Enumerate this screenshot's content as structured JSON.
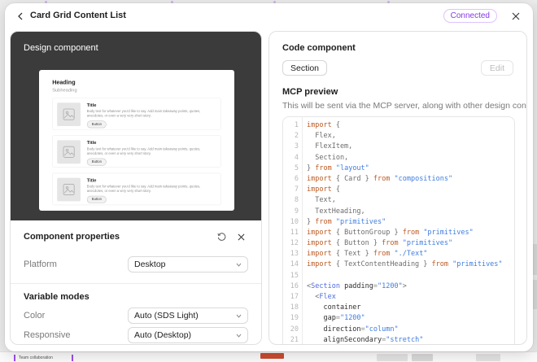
{
  "header": {
    "title": "Card Grid Content List",
    "badge": "Connected"
  },
  "design_panel": {
    "label": "Design component",
    "preview": {
      "heading": "Heading",
      "subheading": "Subheading",
      "cards": [
        {
          "title": "Title",
          "body": "Body text for whatever you'd like to say. Add main takeaway points, quotes, anecdotes, or even a very very short story.",
          "button": "Button"
        },
        {
          "title": "Title",
          "body": "Body text for whatever you'd like to say. Add main takeaway points, quotes, anecdotes, or even a very very short story.",
          "button": "Button"
        },
        {
          "title": "Title",
          "body": "Body text for whatever you'd like to say. Add main takeaway points, quotes, anecdotes, or even a very very short story.",
          "button": "Button"
        }
      ]
    }
  },
  "properties_panel": {
    "title": "Component properties",
    "fields": [
      {
        "label": "Platform",
        "value": "Desktop"
      }
    ],
    "variable_modes": {
      "title": "Variable modes",
      "fields": [
        {
          "label": "Color",
          "value": "Auto (SDS Light)"
        },
        {
          "label": "Responsive",
          "value": "Auto (Desktop)"
        }
      ]
    }
  },
  "code_panel": {
    "title": "Code component",
    "chip": "Section",
    "edit_label": "Edit",
    "mcp": {
      "title": "MCP preview",
      "description": "This will be sent via the MCP server, along with other design context."
    },
    "code": {
      "lines": [
        {
          "n": 1,
          "t": [
            [
              "k",
              "import "
            ],
            [
              "p",
              "{"
            ]
          ]
        },
        {
          "n": 2,
          "t": [
            [
              "p",
              "  Flex,"
            ]
          ]
        },
        {
          "n": 3,
          "t": [
            [
              "p",
              "  FlexItem,"
            ]
          ]
        },
        {
          "n": 4,
          "t": [
            [
              "p",
              "  Section,"
            ]
          ]
        },
        {
          "n": 5,
          "t": [
            [
              "p",
              "} "
            ],
            [
              "k",
              "from "
            ],
            [
              "s",
              "\"layout\""
            ]
          ]
        },
        {
          "n": 6,
          "t": [
            [
              "k",
              "import "
            ],
            [
              "p",
              "{ Card } "
            ],
            [
              "k",
              "from "
            ],
            [
              "s",
              "\"compositions\""
            ]
          ]
        },
        {
          "n": 7,
          "t": [
            [
              "k",
              "import "
            ],
            [
              "p",
              "{"
            ]
          ]
        },
        {
          "n": 8,
          "t": [
            [
              "p",
              "  Text,"
            ]
          ]
        },
        {
          "n": 9,
          "t": [
            [
              "p",
              "  TextHeading,"
            ]
          ]
        },
        {
          "n": 10,
          "t": [
            [
              "p",
              "} "
            ],
            [
              "k",
              "from "
            ],
            [
              "s",
              "\"primitives\""
            ]
          ]
        },
        {
          "n": 11,
          "t": [
            [
              "k",
              "import "
            ],
            [
              "p",
              "{ ButtonGroup } "
            ],
            [
              "k",
              "from "
            ],
            [
              "s",
              "\"primitives\""
            ]
          ]
        },
        {
          "n": 12,
          "t": [
            [
              "k",
              "import "
            ],
            [
              "p",
              "{ Button } "
            ],
            [
              "k",
              "from "
            ],
            [
              "s",
              "\"primitives\""
            ]
          ]
        },
        {
          "n": 13,
          "t": [
            [
              "k",
              "import "
            ],
            [
              "p",
              "{ Text } "
            ],
            [
              "k",
              "from "
            ],
            [
              "s",
              "\"./Text\""
            ]
          ]
        },
        {
          "n": 14,
          "t": [
            [
              "k",
              "import "
            ],
            [
              "p",
              "{ TextContentHeading } "
            ],
            [
              "k",
              "from "
            ],
            [
              "s",
              "\"primitives\""
            ]
          ]
        },
        {
          "n": 15,
          "t": []
        },
        {
          "n": 16,
          "t": [
            [
              "p",
              "<"
            ],
            [
              "t",
              "Section"
            ],
            [
              "a",
              " padding"
            ],
            [
              "e",
              "="
            ],
            [
              "s",
              "\"1200\""
            ],
            [
              "p",
              ">"
            ]
          ]
        },
        {
          "n": 17,
          "t": [
            [
              "p",
              "  <"
            ],
            [
              "t",
              "Flex"
            ]
          ]
        },
        {
          "n": 18,
          "t": [
            [
              "a",
              "    container"
            ]
          ]
        },
        {
          "n": 19,
          "t": [
            [
              "a",
              "    gap"
            ],
            [
              "e",
              "="
            ],
            [
              "s",
              "\"1200\""
            ]
          ]
        },
        {
          "n": 20,
          "t": [
            [
              "a",
              "    direction"
            ],
            [
              "e",
              "="
            ],
            [
              "s",
              "\"column\""
            ]
          ]
        },
        {
          "n": 21,
          "t": [
            [
              "a",
              "    alignSecondary"
            ],
            [
              "e",
              "="
            ],
            [
              "s",
              "\"stretch\""
            ]
          ]
        }
      ]
    }
  },
  "background": {
    "canvas_label": "Team collaboration"
  },
  "colors": {
    "accent_purple": "#8638e5",
    "keyword_orange": "#bc5a23",
    "string_blue": "#3f7de0",
    "tag_blue": "#4f6bdd",
    "dark_panel": "#3b3b3b"
  },
  "icons": {
    "back": "chevron-left",
    "close": "x",
    "reset": "undo-arrow",
    "select": "chevron-down",
    "placeholder": "image"
  }
}
